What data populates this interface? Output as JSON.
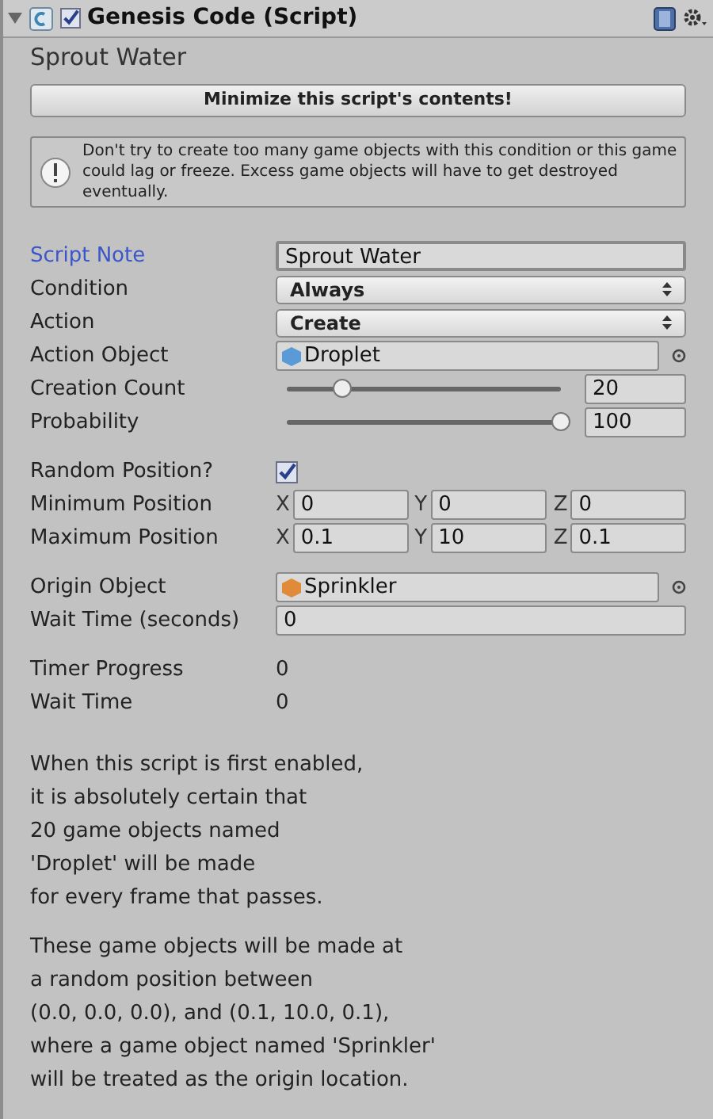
{
  "header": {
    "title": "Genesis Code (Script)",
    "enabled": true,
    "expanded": true
  },
  "subtitle": "Sprout Water",
  "minimize_button": "Minimize this script's contents!",
  "help_box": "Don't try to create too many game objects with this condition or this game could lag or freeze. Excess game objects will have to get destroyed eventually.",
  "sections": [
    [
      {
        "kind": "text",
        "label": "Script Note",
        "value": "Sprout Water",
        "focused": true
      },
      {
        "kind": "dropdown",
        "label": "Condition",
        "value": "Always"
      },
      {
        "kind": "dropdown",
        "label": "Action",
        "value": "Create"
      },
      {
        "kind": "object",
        "label": "Action Object",
        "value": "Droplet",
        "color": "#5a9ad6"
      },
      {
        "kind": "slider",
        "label": "Creation Count",
        "value": "20",
        "level": 0.2
      },
      {
        "kind": "slider",
        "label": "Probability",
        "value": "100",
        "level": 1
      }
    ],
    [
      {
        "kind": "checkbox",
        "label": "Random Position?",
        "checked": true
      },
      {
        "kind": "vector",
        "label": "Minimum Position",
        "axes": [
          {
            "axis": "X",
            "value": "0"
          },
          {
            "axis": "Y",
            "value": "0"
          },
          {
            "axis": "Z",
            "value": "0"
          }
        ]
      },
      {
        "kind": "vector",
        "label": "Maximum Position",
        "axes": [
          {
            "axis": "X",
            "value": "0.1"
          },
          {
            "axis": "Y",
            "value": "10"
          },
          {
            "axis": "Z",
            "value": "0.1"
          }
        ]
      }
    ],
    [
      {
        "kind": "object",
        "label": "Origin Object",
        "value": "Sprinkler",
        "color": "#e08a3a"
      },
      {
        "kind": "text",
        "label": "Wait Time (seconds)",
        "value": "0",
        "focused": false
      }
    ],
    [
      {
        "kind": "readonly",
        "label": "Timer Progress",
        "value": "0"
      },
      {
        "kind": "readonly",
        "label": "Wait Time",
        "value": "0"
      }
    ]
  ],
  "paragraphs": [
    [
      "When this script is first enabled,",
      "it is absolutely certain that",
      "20 game objects named",
      "'Droplet' will be made",
      "for every frame that passes."
    ],
    [
      "These game objects will be made at",
      "a random position between",
      "(0.0, 0.0, 0.0), and (0.1, 10.0, 0.1),",
      "where a game object named 'Sprinkler'",
      "will be treated as the origin location."
    ]
  ]
}
